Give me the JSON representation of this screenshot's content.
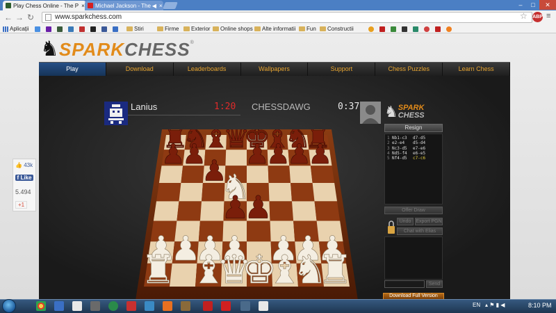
{
  "browser": {
    "tabs": [
      {
        "title": "Play Chess Online - The P",
        "active": true
      },
      {
        "title": "Michael Jackson - The",
        "active": false
      }
    ],
    "url": "www.sparkchess.com",
    "bookmarks": [
      {
        "label": "Aplicații",
        "icon": "apps-icon"
      },
      {
        "label": "",
        "icon": "g-icon"
      },
      {
        "label": "",
        "icon": "yahoo-icon"
      },
      {
        "label": "",
        "icon": "page-icon"
      },
      {
        "label": "",
        "icon": "t-icon"
      },
      {
        "label": "",
        "icon": "rl-icon"
      },
      {
        "label": "",
        "icon": "flag-icon"
      },
      {
        "label": "",
        "icon": "facebook-icon"
      },
      {
        "label": "",
        "icon": "page-icon"
      },
      {
        "label": "Stiri",
        "icon": "folder-icon"
      },
      {
        "label": "Firme",
        "icon": "folder-icon"
      },
      {
        "label": "Exterior",
        "icon": "folder-icon"
      },
      {
        "label": "Online shops",
        "icon": "folder-icon"
      },
      {
        "label": "Alte informatii",
        "icon": "folder-icon"
      },
      {
        "label": "Fun",
        "icon": "folder-icon"
      },
      {
        "label": "Constructii",
        "icon": "folder-icon"
      }
    ]
  },
  "site": {
    "logo": {
      "spark": "SPARK",
      "chess": "CHESS",
      "reg": "®"
    },
    "nav": [
      "Play",
      "Download",
      "Leaderboards",
      "Wallpapers",
      "Support",
      "Chess Puzzles",
      "Learn Chess"
    ],
    "active_nav": "Play"
  },
  "game": {
    "player_left": {
      "name": "Lanius",
      "clock": "1:20"
    },
    "player_right": {
      "name": "CHESSDAWG",
      "clock": "0:37"
    },
    "badge": {
      "spark": "SPARK",
      "chess": "CHESS"
    },
    "resign_label": "Resign",
    "moves": [
      {
        "n": "1",
        "white": "Nb1-c3",
        "black": "d7-d5"
      },
      {
        "n": "2",
        "white": "e2-e4",
        "black": "d5-d4"
      },
      {
        "n": "3",
        "white": "Nc3-d5",
        "black": "e7-e6"
      },
      {
        "n": "4",
        "white": "Nd5-f4",
        "black": "e6-e5"
      },
      {
        "n": "5",
        "white": "Nf4-d5",
        "black": "c7-c6"
      }
    ],
    "buttons": {
      "offer_draw": "Offer Draw",
      "undo": "Undo",
      "export": "Export PGN",
      "chat": "Chat with Elias",
      "send": "Send",
      "download": "Download Full Version"
    }
  },
  "social": {
    "likes": "43k",
    "like_label": "Like",
    "shares": "5.494",
    "gplus": "+1"
  },
  "taskbar": {
    "lang": "EN",
    "time": "8:10 PM"
  }
}
